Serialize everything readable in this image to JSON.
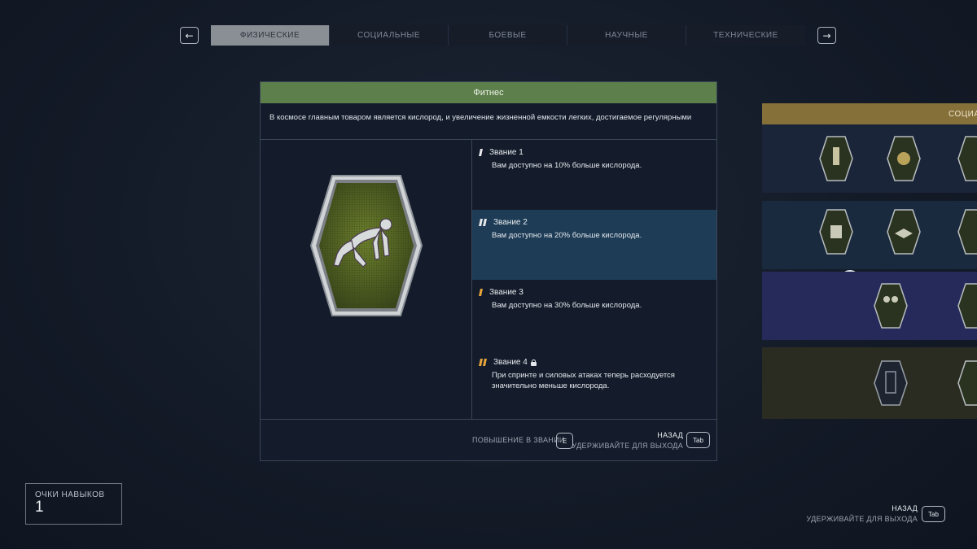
{
  "tabs": {
    "items": [
      "ФИЗИЧЕСКИЕ",
      "СОЦИАЛЬНЫЕ",
      "БОЕВЫЕ",
      "НАУЧНЫЕ",
      "ТЕХНИЧЕСКИЕ"
    ],
    "active_index": 0,
    "prev_icon": "arrow-left-icon",
    "next_icon": "arrow-right-icon"
  },
  "skill": {
    "title": "Фитнес",
    "description": "В космосе главным товаром является кислород, и увеличение жизненной емкости легких, достигаемое регулярными",
    "badge_icon": "sprinter-start-icon",
    "ranks": [
      {
        "title": "Звание 1",
        "text": "Вам доступно на 10% больше кислорода.",
        "status": "unlocked"
      },
      {
        "title": "Звание 2",
        "text": "Вам доступно на 20% больше кислорода.",
        "status": "next"
      },
      {
        "title": "Звание 3",
        "text": "Вам доступно на 30% больше кислорода.",
        "status": "available"
      },
      {
        "title": "Звание 4",
        "text": "При спринте и силовых атаках теперь расходуется значительно меньше кислорода.",
        "status": "locked"
      }
    ]
  },
  "footer": {
    "rank_up_label": "ПОВЫШЕНИЕ В ЗВАНИИ",
    "rank_up_key": "E",
    "back_label": "НАЗАД",
    "hold_label": "УДЕРЖИВАЙТЕ ДЛЯ ВЫХОДА",
    "back_key": "Tab"
  },
  "side_panel": {
    "title": "СОЦИА"
  },
  "skill_points": {
    "label": "ОЧКИ НАВЫКОВ",
    "value": "1"
  },
  "bottom_right": {
    "back_label": "НАЗАД",
    "hold_label": "УДЕРЖИВАЙТЕ ДЛЯ ВЫХОДА",
    "back_key": "Tab"
  },
  "colors": {
    "header_green": "#5d7f4b",
    "header_gold": "#86703a",
    "highlight_blue": "#1e3c56",
    "rank_orange": "#e9a53a"
  }
}
